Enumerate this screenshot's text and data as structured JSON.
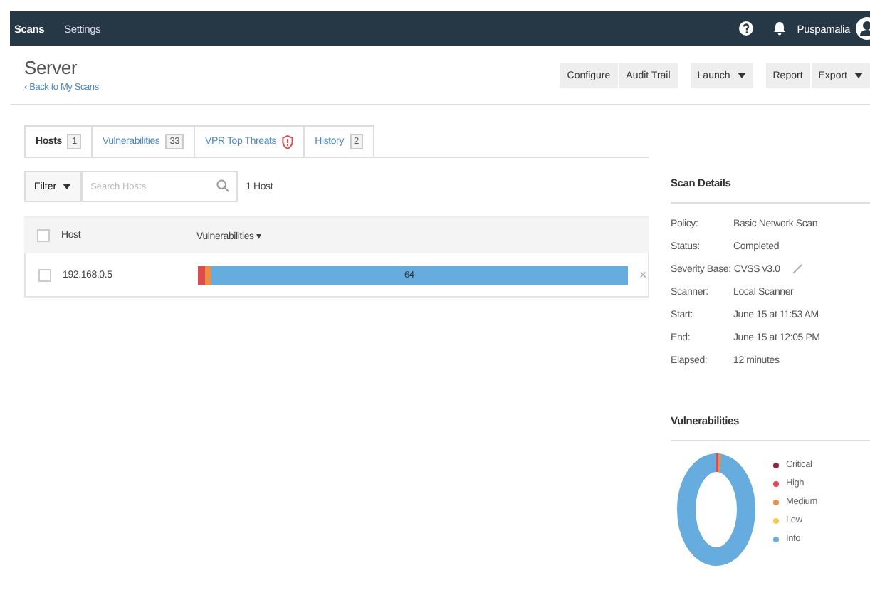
{
  "nav": {
    "items": [
      {
        "label": "Scans",
        "selected": true
      },
      {
        "label": "Settings",
        "selected": false
      }
    ],
    "user": "Puspamalia"
  },
  "header": {
    "title": "Server",
    "back_link": "Back to My Scans",
    "back_icon": "‹",
    "button_groups": [
      [
        {
          "label": "Configure",
          "dropdown": false
        },
        {
          "label": "Audit Trail",
          "dropdown": false
        }
      ],
      [
        {
          "label": "Launch",
          "dropdown": true
        }
      ],
      [
        {
          "label": "Report",
          "dropdown": false
        },
        {
          "label": "Export",
          "dropdown": true
        }
      ]
    ]
  },
  "tabs": [
    {
      "label": "Hosts",
      "count": "1",
      "selected": true,
      "kind": "count"
    },
    {
      "label": "Vulnerabilities",
      "count": "33",
      "selected": false,
      "kind": "count"
    },
    {
      "label": "VPR Top Threats",
      "selected": false,
      "kind": "shield"
    },
    {
      "label": "History",
      "count": "2",
      "selected": false,
      "kind": "count"
    }
  ],
  "filter": {
    "label": "Filter",
    "placeholder": "Search Hosts",
    "result": "1 Host"
  },
  "table": {
    "select_all_checked": false,
    "columns": [
      "Host",
      "Vulnerabilities"
    ],
    "sort_icon": "▾",
    "rows": [
      {
        "host": "192.168.0.5",
        "checked": false,
        "info_count": "64",
        "remove": "×"
      }
    ]
  },
  "scan_details": {
    "title": "Scan Details",
    "rows": [
      {
        "key": "Policy:",
        "value": "Basic Network Scan",
        "editable": false
      },
      {
        "key": "Status:",
        "value": "Completed",
        "editable": false
      },
      {
        "key": "Severity Base:",
        "value": "CVSS v3.0",
        "editable": true
      },
      {
        "key": "Scanner:",
        "value": "Local Scanner",
        "editable": false
      },
      {
        "key": "Start:",
        "value": "June 15 at 11:53 AM",
        "editable": false
      },
      {
        "key": "End:",
        "value": "June 15 at 12:05 PM",
        "editable": false
      },
      {
        "key": "Elapsed:",
        "value": "12 minutes",
        "editable": false
      }
    ]
  },
  "vulnerabilities": {
    "title": "Vulnerabilities",
    "legend": [
      {
        "label": "Critical",
        "color": "#91243e"
      },
      {
        "label": "High",
        "color": "#dd4b50"
      },
      {
        "label": "Medium",
        "color": "#f18c43"
      },
      {
        "label": "Low",
        "color": "#f8c851"
      },
      {
        "label": "Info",
        "color": "#67acdf"
      }
    ]
  }
}
